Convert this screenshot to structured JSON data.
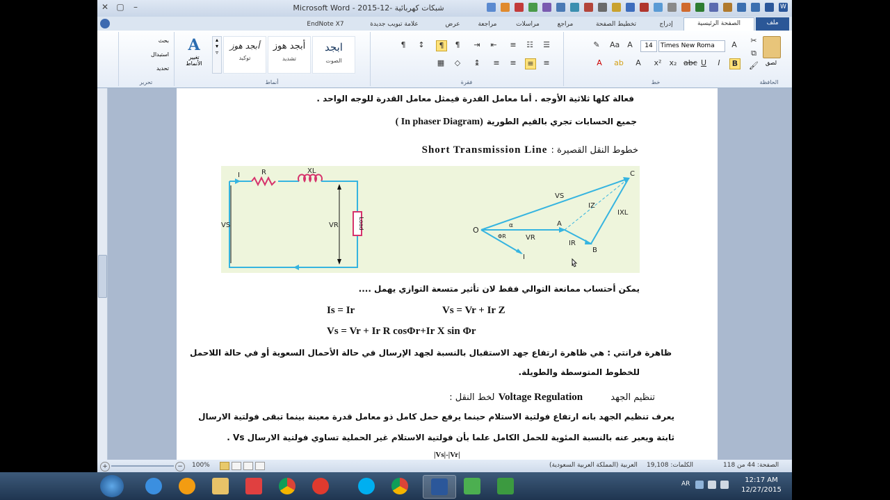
{
  "window": {
    "title": "شبكات كهربائية -12-2015  - Microsoft Word",
    "minimize": "–",
    "maximize": "▢",
    "close": "✕"
  },
  "tabs": [
    {
      "label": "ملف",
      "active": false,
      "file": true
    },
    {
      "label": "الصفحة الرئيسية",
      "active": true
    },
    {
      "label": "إدراج"
    },
    {
      "label": "تخطيط الصفحة"
    },
    {
      "label": "مراجع"
    },
    {
      "label": "مراسلات"
    },
    {
      "label": "مراجعة"
    },
    {
      "label": "عرض"
    },
    {
      "label": "علامة تبويب جديدة"
    },
    {
      "label": "EndNote X7"
    }
  ],
  "ribbon": {
    "groups": {
      "clipboard": "الحافظة",
      "font": "خط",
      "paragraph": "فقرة",
      "styles": "أنماط",
      "editing": "تحرير"
    },
    "paste_label": "لصق",
    "font_name": "Times New Roma",
    "font_size": "14",
    "styles": [
      {
        "sample": "ابجد",
        "name": "الصوت"
      },
      {
        "sample": "أبجد هوز",
        "name": "تشديد"
      },
      {
        "sample": "أبجد هوز",
        "name": "توكيد"
      }
    ],
    "change_styles": "تغيير الأنماط",
    "editing_items": [
      "بحث",
      "استبدال",
      "تحديد"
    ]
  },
  "document": {
    "line1": "فعالة كلها ثلاثية الأوجه . أما معامل القدرة فيمثل معامل القدرة للوجه الواحد .",
    "line2_ar": "جميع الحسابات تجري بالقيم الطورية",
    "line2_en": "(In phaser Diagram )",
    "heading_ar": "خطوط النقل القصيرة :",
    "heading_en": "Short  Transmission  Line",
    "note": "يمكن أحتساب ممانعة التوالي فقط لان تأثير متسعة التوازي يهمل ....",
    "eq1_left": "Is  = Ir",
    "eq1_right": "Vs  = Vr  + Ir Z",
    "eq2": "Vs = Vr +  Ir R cosΦr+Ir X sin Φr",
    "ferranti1": "ظاهرة فرانتي : هي ظاهرة ارتفاع جهد الاستقبال بالنسبة لجهد الإرسال في حالة الأحمال السعوية أو في حالة اللاحمل",
    "ferranti2": "للخطوط المتوسطة والطويلة.",
    "vr_heading_ar1": "تنظيم الجهد",
    "vr_heading_en": "Voltage Regulation",
    "vr_heading_ar2": "لخط النقل :",
    "vr_def1": "يعرف تنظيم الجهد بانه ارتفاع فولتية الاستلام حينما يرفع حمل كامل ذو معامل قدرة معينة بينما تبقى فولتية الارسال",
    "vr_def2": "ثابتة ويعبر عنه بالنسبة المئوية للحمل الكامل علما بأن فولتية الاستلام غير الحملية تساوي فولتية الارسال Vs .",
    "cutoff": "|Vs|-|Vr|"
  },
  "diagram": {
    "labels": {
      "I": "I",
      "R": "R",
      "XL": "XL",
      "Vs": "VS",
      "Vr": "VR",
      "load": "Load",
      "O": "O",
      "A": "A",
      "B": "B",
      "C": "C",
      "vs_vec": "VS",
      "vr_vec": "VR",
      "iz": "IZ",
      "ir": "IR",
      "ix": "IXL",
      "i_vec": "I",
      "alpha": "α",
      "phi": "ΦR"
    }
  },
  "status": {
    "page": "الصفحة: 44 من 118",
    "words": "الكلمات: 19,108",
    "language": "العربية (المملكة العربية السعودية)",
    "zoom": "100%"
  },
  "clock": {
    "time": "12:17 AM",
    "date": "12/27/2015",
    "lang": "AR"
  },
  "colors": {
    "diagram_bg": "#eef5dc",
    "wire": "#35b4e0",
    "load_box": "#d6336c"
  }
}
